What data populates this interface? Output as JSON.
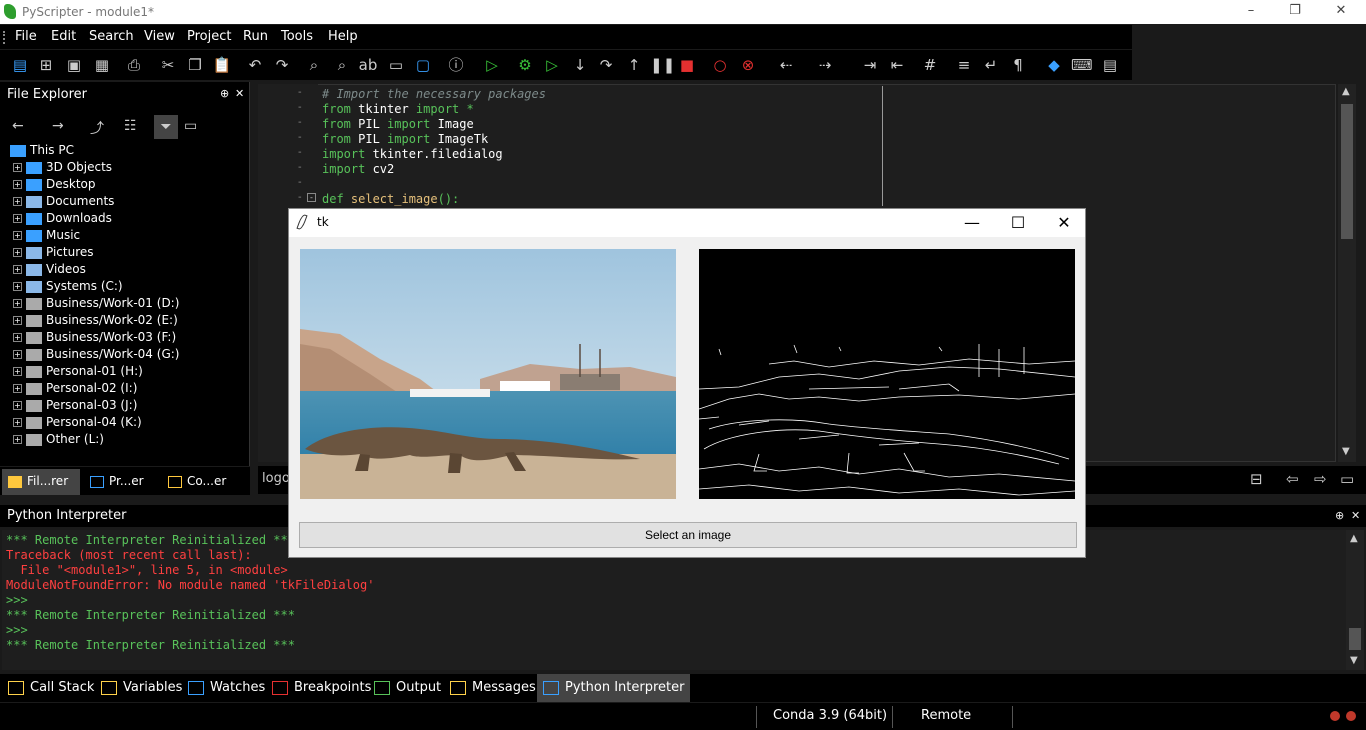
{
  "window": {
    "title": "PyScripter - module1*",
    "minimize": "–",
    "restore": "❐",
    "close": "✕"
  },
  "menu": [
    "File",
    "Edit",
    "Search",
    "View",
    "Project",
    "Run",
    "Tools",
    "Help"
  ],
  "toolbar": {
    "icons": [
      "new-file-icon",
      "open-file-icon",
      "save-icon",
      "save-all-icon",
      "print-icon",
      "cut-icon",
      "copy-icon",
      "paste-icon",
      "undo-icon",
      "redo-icon",
      "find-icon",
      "find-next-icon",
      "replace-icon",
      "find-in-files-icon",
      "goto-icon",
      "info-icon",
      "run-icon",
      "debug-icon",
      "run-to-cursor-icon",
      "step-into-icon",
      "step-over-icon",
      "step-out-icon",
      "pause-icon",
      "stop-icon",
      "toggle-breakpoint-icon",
      "clear-breakpoints-icon",
      "back-icon",
      "forward-icon",
      "indent-icon",
      "unindent-icon",
      "comment-icon",
      "list-icon",
      "wrap-icon",
      "pilcrow-icon",
      "python-icon",
      "keyboard-icon",
      "layout-icon"
    ]
  },
  "file_explorer": {
    "title": "File Explorer",
    "root": "This PC",
    "items": [
      "3D Objects",
      "Desktop",
      "Documents",
      "Downloads",
      "Music",
      "Pictures",
      "Videos",
      "Systems (C:)",
      "Business/Work-01 (D:)",
      "Business/Work-02 (E:)",
      "Business/Work-03 (F:)",
      "Business/Work-04 (G:)",
      "Personal-01 (H:)",
      "Personal-02 (I:)",
      "Personal-03 (J:)",
      "Personal-04 (K:)",
      "Other (L:)"
    ],
    "tabs": [
      "Fil...rer",
      "Pr...er",
      "Co...er"
    ]
  },
  "editor": {
    "lines": [
      {
        "parts": [
          {
            "t": "# Import the necessary packages",
            "c": "cm"
          }
        ]
      },
      {
        "parts": [
          {
            "t": "from ",
            "c": "kw"
          },
          {
            "t": "tkinter ",
            "c": ""
          },
          {
            "t": "import ",
            "c": "kw"
          },
          {
            "t": "*",
            "c": "kw"
          }
        ]
      },
      {
        "parts": [
          {
            "t": "from ",
            "c": "kw"
          },
          {
            "t": "PIL ",
            "c": ""
          },
          {
            "t": "import ",
            "c": "kw"
          },
          {
            "t": "Image",
            "c": ""
          }
        ]
      },
      {
        "parts": [
          {
            "t": "from ",
            "c": "kw"
          },
          {
            "t": "PIL ",
            "c": ""
          },
          {
            "t": "import ",
            "c": "kw"
          },
          {
            "t": "ImageTk",
            "c": ""
          }
        ]
      },
      {
        "parts": [
          {
            "t": "import ",
            "c": "kw"
          },
          {
            "t": "tkinter.filedialog",
            "c": ""
          }
        ]
      },
      {
        "parts": [
          {
            "t": "import ",
            "c": "kw"
          },
          {
            "t": "cv2",
            "c": ""
          }
        ]
      },
      {
        "parts": [
          {
            "t": "",
            "c": ""
          }
        ]
      },
      {
        "parts": [
          {
            "t": "def ",
            "c": "kw"
          },
          {
            "t": "select_image",
            "c": "fn"
          },
          {
            "t": "():",
            "c": "kw"
          }
        ]
      }
    ],
    "log_label": "logo"
  },
  "tk_window": {
    "title": "tk",
    "button": "Select an image",
    "minimize": "—",
    "maximize": "☐",
    "close": "✕"
  },
  "interpreter": {
    "title": "Python Interpreter",
    "lines": [
      {
        "text": "*** Remote Interpreter Reinitialized ***",
        "c": "g"
      },
      {
        "text": "Traceback (most recent call last):",
        "c": "r"
      },
      {
        "text": "  File \"<module1>\", line 5, in <module>",
        "c": "r"
      },
      {
        "text": "ModuleNotFoundError: No module named 'tkFileDialog'",
        "c": "r"
      },
      {
        "text": ">>>",
        "c": "g"
      },
      {
        "text": "*** Remote Interpreter Reinitialized ***",
        "c": "g"
      },
      {
        "text": ">>>",
        "c": "g"
      },
      {
        "text": "*** Remote Interpreter Reinitialized ***",
        "c": "g"
      }
    ]
  },
  "bottom_tabs": [
    "Call Stack",
    "Variables",
    "Watches",
    "Breakpoints",
    "Output",
    "Messages",
    "Python Interpreter"
  ],
  "status": {
    "env": "Conda 3.9 (64bit)",
    "mode": "Remote"
  }
}
